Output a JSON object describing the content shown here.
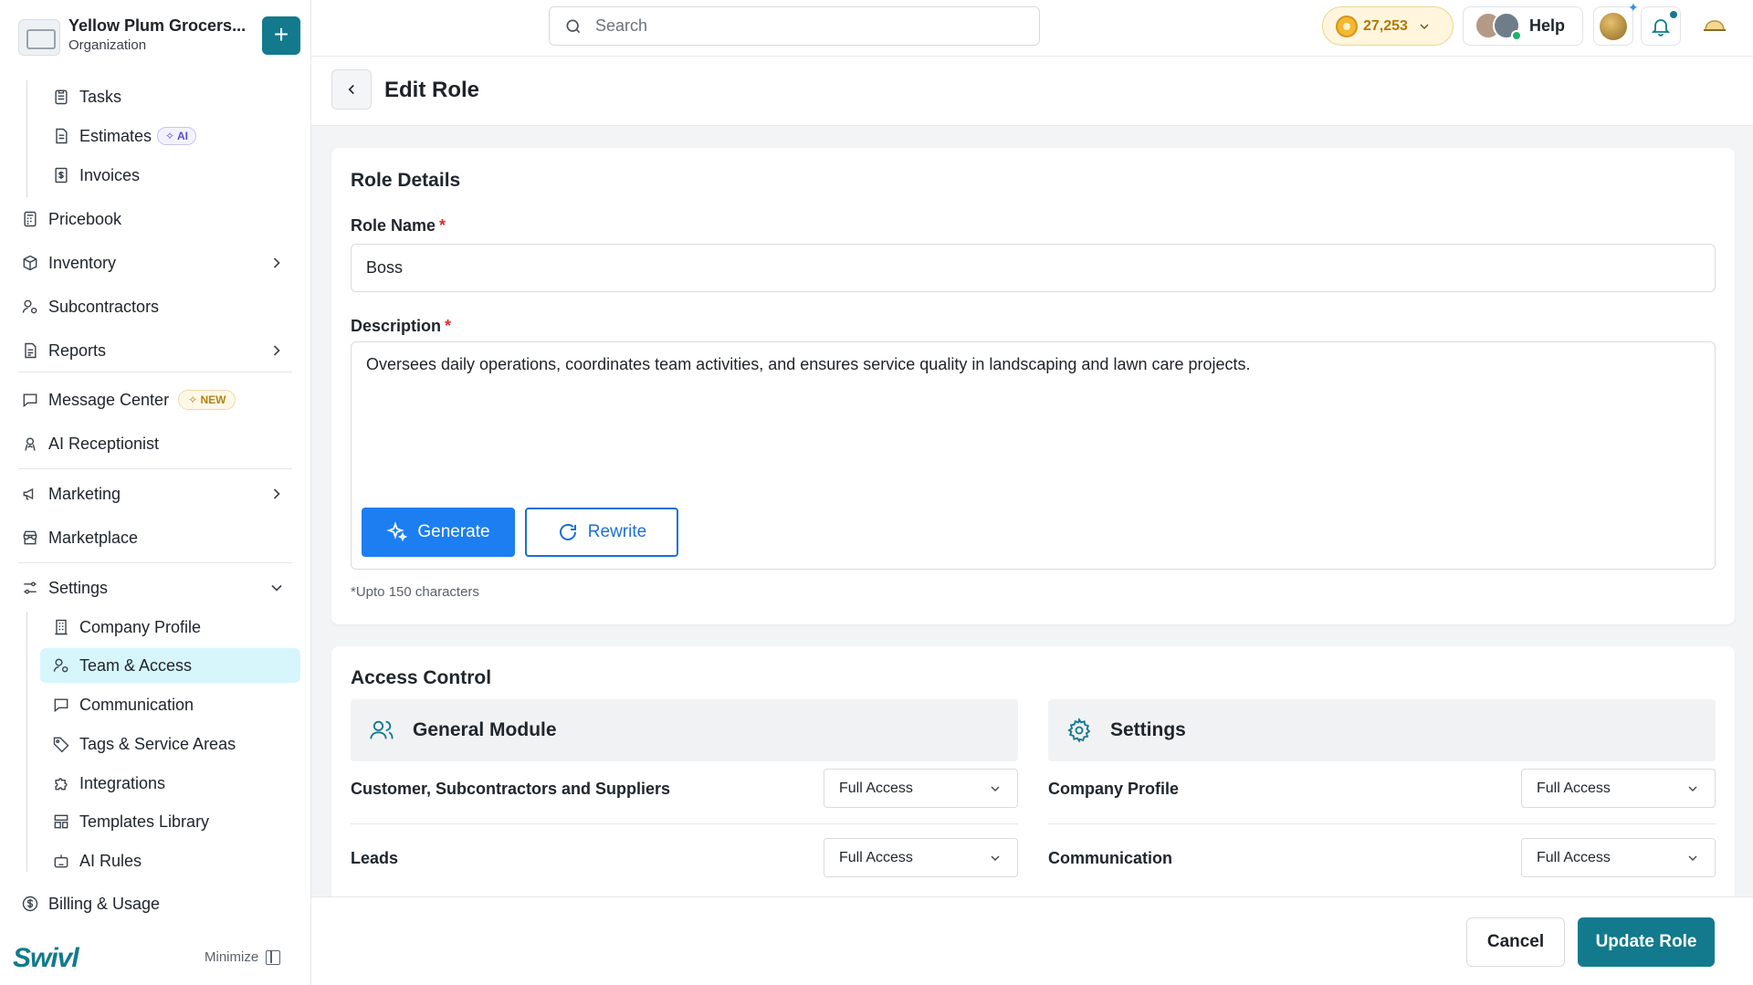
{
  "org": {
    "name": "Yellow Plum Grocers...",
    "subtitle": "Organization",
    "add_label": "+"
  },
  "sidebar": {
    "tasks": "Tasks",
    "estimates": "Estimates",
    "estimates_badge": "AI",
    "invoices": "Invoices",
    "pricebook": "Pricebook",
    "inventory": "Inventory",
    "subcontractors": "Subcontractors",
    "reports": "Reports",
    "message_center": "Message Center",
    "message_center_badge": "NEW",
    "ai_receptionist": "AI Receptionist",
    "marketing": "Marketing",
    "marketplace": "Marketplace",
    "settings": "Settings",
    "company_profile": "Company Profile",
    "team_access": "Team & Access",
    "communication": "Communication",
    "tags_service_areas": "Tags & Service Areas",
    "integrations": "Integrations",
    "templates_library": "Templates Library",
    "ai_rules": "AI Rules",
    "billing_usage": "Billing & Usage",
    "brand": "Swivl",
    "minimize": "Minimize"
  },
  "topbar": {
    "search_placeholder": "Search",
    "coins": "27,253",
    "help": "Help"
  },
  "page": {
    "title": "Edit Role"
  },
  "role_details": {
    "title": "Role Details",
    "role_name_label": "Role Name",
    "role_name_value": "Boss",
    "description_label": "Description",
    "description_value": "Oversees daily operations, coordinates team activities, and ensures service quality in landscaping and lawn care projects.",
    "generate_label": "Generate",
    "rewrite_label": "Rewrite",
    "hint": "*Upto 150 characters",
    "required_mark": "*"
  },
  "access_control": {
    "title": "Access Control",
    "general_module": {
      "title": "General Module",
      "rows": [
        {
          "label": "Customer, Subcontractors and Suppliers",
          "value": "Full Access"
        },
        {
          "label": "Leads",
          "value": "Full Access"
        }
      ]
    },
    "settings_module": {
      "title": "Settings",
      "rows": [
        {
          "label": "Company Profile",
          "value": "Full Access"
        },
        {
          "label": "Communication",
          "value": "Full Access"
        }
      ]
    }
  },
  "footer": {
    "cancel": "Cancel",
    "update": "Update Role"
  }
}
